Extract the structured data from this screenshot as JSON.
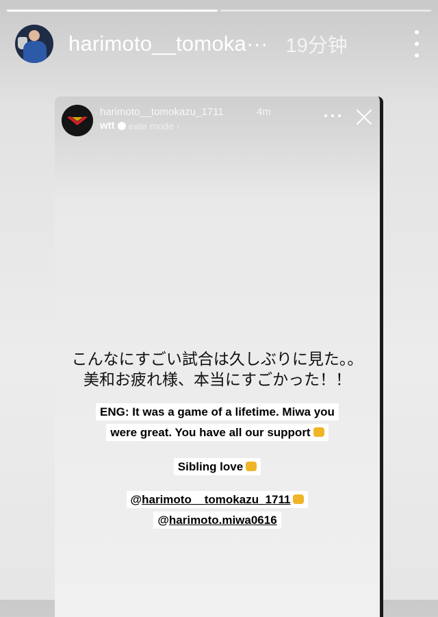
{
  "story": {
    "progress": [
      1.0,
      0.0
    ],
    "username": "harimoto__tomoka···",
    "time_ago": "19分钟"
  },
  "card": {
    "username": "harimoto__tomokazu_1711",
    "time_ago": "4m",
    "sub_brand": "wtt",
    "sub_mode": "eate mode ›",
    "jp_line1": "こんなにすごい試合は久しぶりに見た。。",
    "jp_line2": "美和お疲れ様、本当にすごかった！！",
    "eng_line1": "ENG: It was a game of a lifetime. Miwa you",
    "eng_line2": "were great. You have all our support",
    "sibling": "Sibling love",
    "tag_prefix": "@",
    "tag1": "harimoto__tomokazu_1711",
    "tag2": "harimoto.miwa0616"
  },
  "colors": {
    "brand_red": "#d4202a",
    "emoji_yellow": "#f0b429"
  },
  "icons": {
    "more": "more-vertical-icon",
    "close": "close-icon",
    "verified": "verified-badge-icon"
  }
}
